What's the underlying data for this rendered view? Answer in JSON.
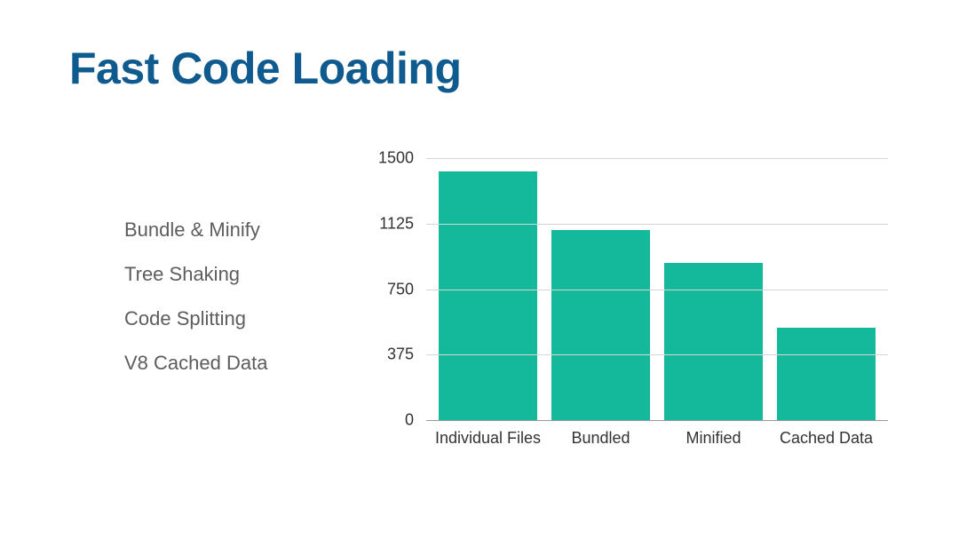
{
  "title": "Fast Code Loading",
  "bullets": [
    "Bundle & Minify",
    "Tree Shaking",
    "Code Splitting",
    "V8 Cached Data"
  ],
  "chart_data": {
    "type": "bar",
    "categories": [
      "Individual Files",
      "Bundled",
      "Minified",
      "Cached Data"
    ],
    "values": [
      1425,
      1090,
      900,
      530
    ],
    "title": "",
    "xlabel": "",
    "ylabel": "",
    "ylim": [
      0,
      1500
    ],
    "y_ticks": [
      0,
      375,
      750,
      1125,
      1500
    ],
    "bar_color": "#14b89a"
  }
}
